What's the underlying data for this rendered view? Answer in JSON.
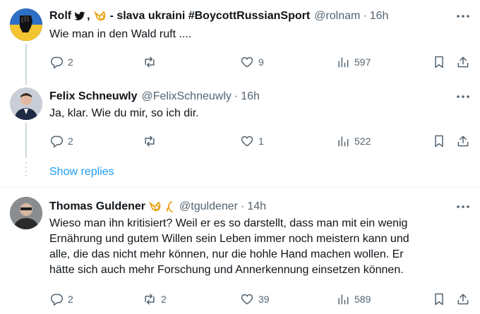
{
  "tweets": [
    {
      "name": "Rolf",
      "name_suffix": ",",
      "name_tail": "- slava ukraini #BoycottRussianSport",
      "handle": "@rolnam",
      "time": "16h",
      "text": "Wie man in den Wald ruft ....",
      "replies": "2",
      "retweets": "",
      "likes": "9",
      "views": "597"
    },
    {
      "name": "Felix Schneuwly",
      "handle": "@FelixSchneuwly",
      "time": "16h",
      "text": "Ja, klar. Wie du mir, so ich dir.",
      "replies": "2",
      "retweets": "",
      "likes": "1",
      "views": "522"
    },
    {
      "name": "Thomas Guldener",
      "handle": "@tguldener",
      "time": "14h",
      "text_lines": [
        "Wieso man ihn kritisiert? Weil er es so darstellt, dass man mit ein wenig",
        "Ernährung und gutem Willen sein Leben immer noch meistern kann und",
        "alle, die das nicht mehr können, nur die hohle Hand machen wollen. Er",
        "hätte sich auch mehr Forschung und Annerkennung einsetzen können."
      ],
      "replies": "2",
      "retweets": "2",
      "likes": "39",
      "views": "589"
    }
  ],
  "show_replies": "Show replies",
  "colors": {
    "accent": "#1d9bf0",
    "muted": "#536471",
    "text": "#0f1419",
    "line": "#cfd9de"
  },
  "icons": [
    "reply-icon",
    "retweet-icon",
    "like-icon",
    "views-icon",
    "bookmark-icon",
    "share-icon",
    "more-icon",
    "twitter-bird-icon",
    "horn-icon"
  ]
}
